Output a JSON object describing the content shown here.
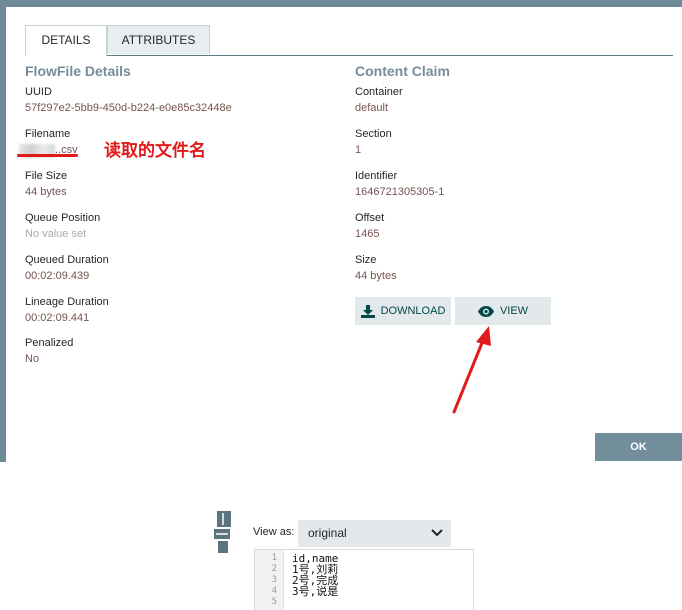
{
  "tabs": [
    {
      "label": "DETAILS",
      "active": true
    },
    {
      "label": "ATTRIBUTES",
      "active": false
    }
  ],
  "flowfile_details": {
    "title": "FlowFile Details",
    "uuid_label": "UUID",
    "uuid": "57f297e2-5bb9-450d-b224-e0e85c32448e",
    "filename_label": "Filename",
    "filename_visible_suffix": "..csv",
    "file_size_label": "File Size",
    "file_size": "44 bytes",
    "queue_position_label": "Queue Position",
    "queue_position": "No value set",
    "queued_duration_label": "Queued Duration",
    "queued_duration": "00:02:09.439",
    "lineage_duration_label": "Lineage Duration",
    "lineage_duration": "00:02:09.441",
    "penalized_label": "Penalized",
    "penalized": "No"
  },
  "annotation": "读取的文件名",
  "content_claim": {
    "title": "Content Claim",
    "container_label": "Container",
    "container": "default",
    "section_label": "Section",
    "section": "1",
    "identifier_label": "Identifier",
    "identifier": "1646721305305-1",
    "offset_label": "Offset",
    "offset": "1465",
    "size_label": "Size",
    "size": "44 bytes",
    "download_label": "DOWNLOAD",
    "view_label": "VIEW"
  },
  "ok_label": "OK",
  "content_viewer": {
    "view_as_label": "View as:",
    "view_as_selected": "original",
    "line_numbers": [
      "1",
      "2",
      "3",
      "4",
      "5"
    ],
    "lines": [
      "id,name",
      "1号,刘莉",
      "2号,完成",
      "3号,说是",
      ""
    ]
  },
  "colors": {
    "frame": "#6f8a97",
    "section_title": "#728e9b",
    "value_text": "#775351",
    "annotation": "#e11b1b",
    "button_bg": "#e3e8eb",
    "ok_bg": "#728e9b"
  }
}
